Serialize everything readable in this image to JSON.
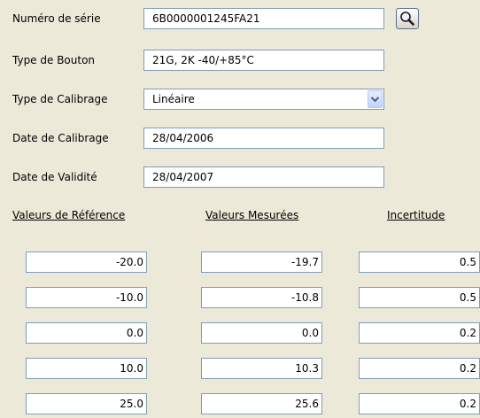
{
  "form": {
    "serial_number": {
      "label": "Numéro de série",
      "value": "6B0000001245FA21"
    },
    "button_type": {
      "label": "Type de Bouton",
      "value": "21G, 2K -40/+85°C"
    },
    "calibration_type": {
      "label": "Type de Calibrage",
      "value": "Linéaire"
    },
    "calibration_date": {
      "label": "Date de Calibrage",
      "value": "28/04/2006"
    },
    "validity_date": {
      "label": "Date de Validité",
      "value": "28/04/2007"
    }
  },
  "table": {
    "headers": [
      "Valeurs de Référence",
      "Valeurs Mesurées",
      "Incertitude"
    ],
    "rows": [
      [
        "-20.0",
        "-19.7",
        "0.5"
      ],
      [
        "-10.0",
        "-10.8",
        "0.5"
      ],
      [
        "0.0",
        "0.0",
        "0.2"
      ],
      [
        "10.0",
        "10.3",
        "0.2"
      ],
      [
        "25.0",
        "25.6",
        "0.2"
      ]
    ]
  },
  "icons": {
    "search": "search-icon",
    "dropdown": "chevron-down-icon"
  }
}
